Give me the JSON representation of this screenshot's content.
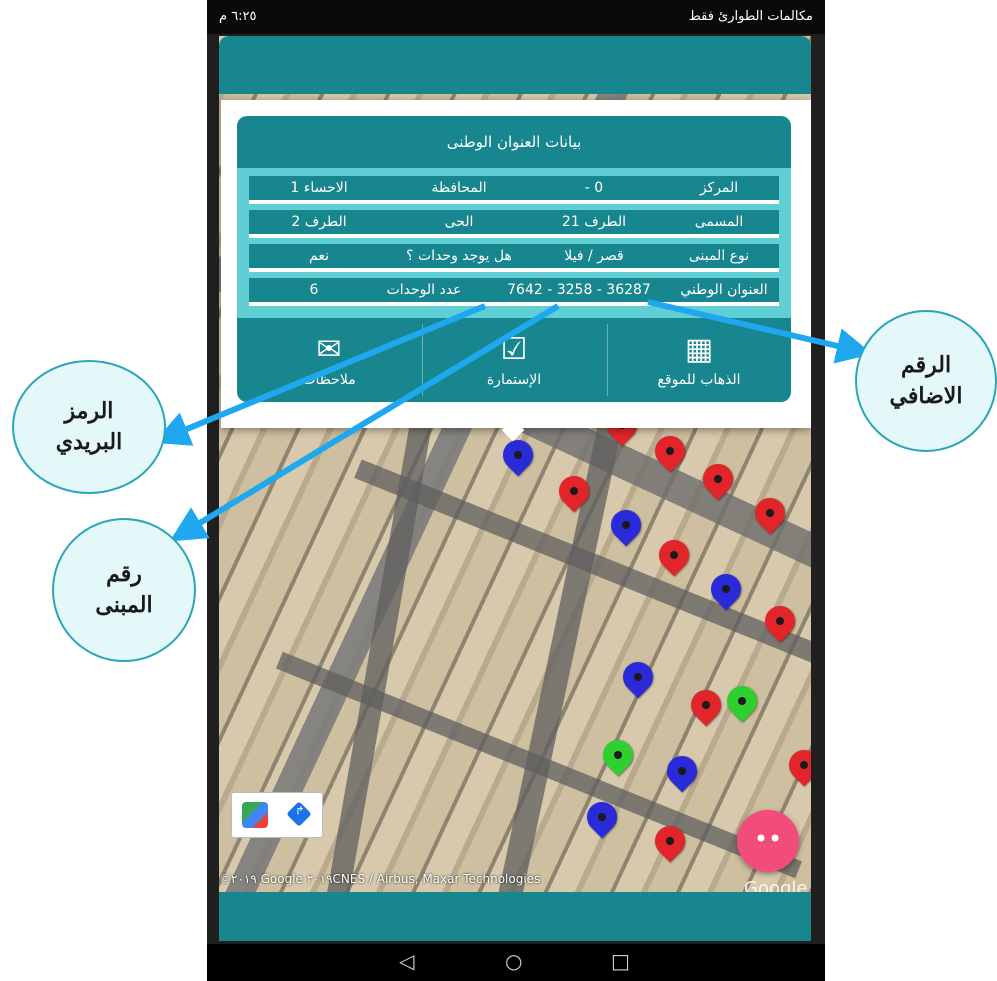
{
  "statusbar": {
    "time": "٦:٢٥ م",
    "carrier": "مكالمات الطوارئ فقط"
  },
  "popup": {
    "title": "بيانات العنوان الوطنى",
    "rows": [
      {
        "l1": "المركز",
        "v1": "- 0",
        "l2": "المحافظة",
        "v2": "1 الاحساء"
      },
      {
        "l1": "المسمى",
        "v1": "21 الطرف",
        "l2": "الحى",
        "v2": "2 الطرف"
      },
      {
        "l1": "نوع المبنى",
        "v1": "قصر / فيلا",
        "l2": "هل يوجد وحدات ؟",
        "v2": "نعم"
      },
      {
        "l1": "العنوان الوطني",
        "v1": "7642 - 3258 - 36287",
        "l2": "عدد الوحدات",
        "v2": "6"
      }
    ],
    "actions": [
      {
        "label": "الذهاب للموقع",
        "icon": "map-navigate-icon"
      },
      {
        "label": "الإستمارة",
        "icon": "form-checklist-icon"
      },
      {
        "label": "ملاحظات",
        "icon": "envelope-icon"
      }
    ]
  },
  "map": {
    "attribution": "©٢٠١٩ Google ٢٠١٩CNES / Airbus, Maxar Technologies",
    "watermark": "Google",
    "fab_label": "••"
  },
  "annotations": {
    "extra_number": [
      "الرقم",
      "الاضافي"
    ],
    "postal_code": [
      "الرمز",
      "البريدي"
    ],
    "building_number": [
      "رقم",
      "المبنى"
    ]
  },
  "colors": {
    "teal": "#17868e",
    "light_teal": "#5fcfd3",
    "arrow": "#1fa8f0",
    "fab": "#f24c7a"
  }
}
